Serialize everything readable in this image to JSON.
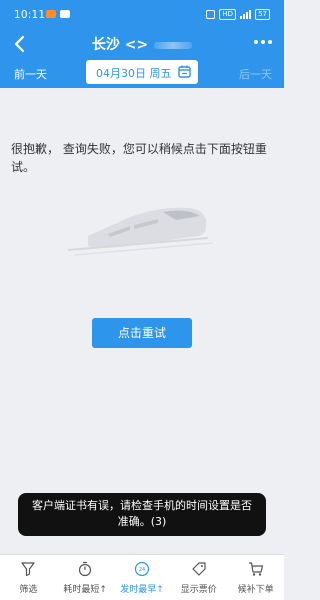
{
  "status": {
    "time": "10:11",
    "network_badge": "HD",
    "battery_badge": "57"
  },
  "header": {
    "title": "长沙 <>"
  },
  "datebar": {
    "prev_label": "前一天",
    "date_label": "04月30日 周五",
    "next_label": "后一天"
  },
  "main": {
    "error_message": "很抱歉， 查询失败，您可以稍候点击下面按钮重试。",
    "retry_label": "点击重试"
  },
  "toast": {
    "message": "客户端证书有误，请检查手机的时间设置是否准确。(3)"
  },
  "tabs": [
    {
      "label": "筛选",
      "icon": "filter-icon"
    },
    {
      "label": "耗时最短↑",
      "icon": "stopwatch-icon"
    },
    {
      "label": "发时最早↑",
      "icon": "clock-icon",
      "active": true
    },
    {
      "label": "显示票价",
      "icon": "price-tag-icon"
    },
    {
      "label": "候补下单",
      "icon": "cart-icon"
    }
  ],
  "colors": {
    "primary": "#2f95ec",
    "toast": "#111111"
  }
}
